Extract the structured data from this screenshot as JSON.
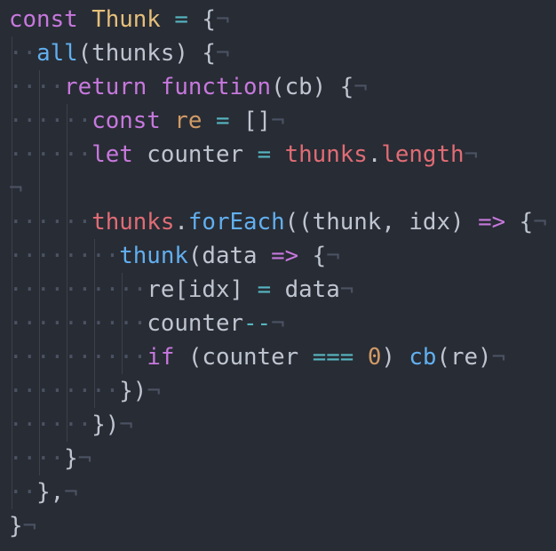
{
  "editor": {
    "theme": {
      "background": "#282c34",
      "text": "#bfc5d0",
      "keyword": "#c678dd",
      "class": "#e5c07b",
      "operator": "#56b6c2",
      "function": "#61afef",
      "variable": "#e06c75",
      "number": "#d19a66",
      "invisibles": "#4b5263"
    },
    "lines": [
      {
        "indent": 0,
        "tokens": [
          {
            "t": "const",
            "c": "kw"
          },
          {
            "t": " ",
            "c": "txt"
          },
          {
            "t": "Thunk",
            "c": "cls"
          },
          {
            "t": " ",
            "c": "txt"
          },
          {
            "t": "=",
            "c": "op"
          },
          {
            "t": " {",
            "c": "txt"
          }
        ]
      },
      {
        "indent": 1,
        "tokens": [
          {
            "t": "all",
            "c": "fn"
          },
          {
            "t": "(thunks) {",
            "c": "txt"
          }
        ]
      },
      {
        "indent": 2,
        "tokens": [
          {
            "t": "return",
            "c": "kw"
          },
          {
            "t": " ",
            "c": "txt"
          },
          {
            "t": "function",
            "c": "kw"
          },
          {
            "t": "(cb) {",
            "c": "txt"
          }
        ]
      },
      {
        "indent": 3,
        "tokens": [
          {
            "t": "const",
            "c": "kw"
          },
          {
            "t": " ",
            "c": "txt"
          },
          {
            "t": "re",
            "c": "const"
          },
          {
            "t": " ",
            "c": "txt"
          },
          {
            "t": "=",
            "c": "op"
          },
          {
            "t": " []",
            "c": "txt"
          }
        ]
      },
      {
        "indent": 3,
        "tokens": [
          {
            "t": "let",
            "c": "kw"
          },
          {
            "t": " counter ",
            "c": "txt"
          },
          {
            "t": "=",
            "c": "op"
          },
          {
            "t": " ",
            "c": "txt"
          },
          {
            "t": "thunks",
            "c": "var"
          },
          {
            "t": ".",
            "c": "txt"
          },
          {
            "t": "length",
            "c": "var"
          }
        ]
      },
      {
        "indent": 0,
        "tokens": []
      },
      {
        "indent": 3,
        "tokens": [
          {
            "t": "thunks",
            "c": "var"
          },
          {
            "t": ".",
            "c": "txt"
          },
          {
            "t": "forEach",
            "c": "fn"
          },
          {
            "t": "((thunk, idx) ",
            "c": "txt"
          },
          {
            "t": "=>",
            "c": "kw"
          },
          {
            "t": " {",
            "c": "txt"
          }
        ]
      },
      {
        "indent": 4,
        "tokens": [
          {
            "t": "thunk",
            "c": "fn"
          },
          {
            "t": "(data ",
            "c": "txt"
          },
          {
            "t": "=>",
            "c": "kw"
          },
          {
            "t": " {",
            "c": "txt"
          }
        ]
      },
      {
        "indent": 5,
        "tokens": [
          {
            "t": "re[idx] ",
            "c": "txt"
          },
          {
            "t": "=",
            "c": "op"
          },
          {
            "t": " data",
            "c": "txt"
          }
        ]
      },
      {
        "indent": 5,
        "tokens": [
          {
            "t": "counter",
            "c": "txt"
          },
          {
            "t": "--",
            "c": "op"
          }
        ]
      },
      {
        "indent": 5,
        "tokens": [
          {
            "t": "if",
            "c": "kw"
          },
          {
            "t": " (counter ",
            "c": "txt"
          },
          {
            "t": "===",
            "c": "op"
          },
          {
            "t": " ",
            "c": "txt"
          },
          {
            "t": "0",
            "c": "num"
          },
          {
            "t": ") ",
            "c": "txt"
          },
          {
            "t": "cb",
            "c": "fn"
          },
          {
            "t": "(re)",
            "c": "txt"
          }
        ]
      },
      {
        "indent": 4,
        "tokens": [
          {
            "t": "})",
            "c": "txt"
          }
        ]
      },
      {
        "indent": 3,
        "tokens": [
          {
            "t": "})",
            "c": "txt"
          }
        ]
      },
      {
        "indent": 2,
        "tokens": [
          {
            "t": "}",
            "c": "txt"
          }
        ]
      },
      {
        "indent": 1,
        "tokens": [
          {
            "t": "},",
            "c": "txt"
          }
        ]
      },
      {
        "indent": 0,
        "tokens": [
          {
            "t": "}",
            "c": "txt"
          }
        ]
      }
    ]
  }
}
